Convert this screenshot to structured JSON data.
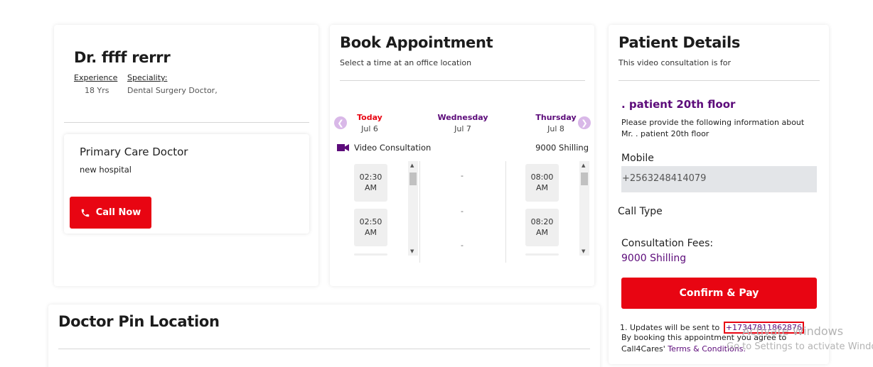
{
  "doctor": {
    "name": "Dr. ffff rerrr",
    "experience_label": "Experience",
    "experience_value": "18 Yrs",
    "speciality_label": "Speciality:",
    "speciality_value": "Dental Surgery Doctor,",
    "card_title": "Primary Care Doctor",
    "hospital": "new hospital",
    "call_button": "Call Now"
  },
  "appointment": {
    "title": "Book Appointment",
    "subtitle": "Select a time at an office location",
    "days": [
      {
        "name": "Today",
        "date": "Jul 6",
        "color": "#e80512"
      },
      {
        "name": "Wednesday",
        "date": "Jul 7",
        "color": "#5c0b7a"
      },
      {
        "name": "Thursday",
        "date": "Jul 8",
        "color": "#5c0b7a"
      }
    ],
    "consultation_type": "Video Consultation",
    "fee": "9000 Shilling",
    "slots_today": [
      {
        "time": "02:30",
        "period": "AM"
      },
      {
        "time": "02:50",
        "period": "AM"
      }
    ],
    "slots_thursday": [
      {
        "time": "08:00",
        "period": "AM"
      },
      {
        "time": "08:20",
        "period": "AM"
      }
    ],
    "empty_marker": "-"
  },
  "patient": {
    "title": "Patient Details",
    "subtitle": "This video consultation is for",
    "name": ". patient 20th floor",
    "info_line1": "Please provide the following information about",
    "info_line2": "Mr. . patient 20th floor",
    "mobile_label": "Mobile",
    "mobile_value": "+2563248414079",
    "call_type_label": "Call Type",
    "fees_label": "Consultation Fees:",
    "fees_value": "9000 Shilling",
    "confirm_button": "Confirm & Pay",
    "updates_prefix": "1. Updates will be sent to",
    "updates_number": "+17347811862876",
    "terms_line1": "By booking this appointment you agree to",
    "terms_prefix": "Call4Cares'",
    "terms_link": "Terms & Conditions."
  },
  "pin": {
    "title": "Doctor Pin Location"
  },
  "watermark": {
    "line1": "Activate Windows",
    "line2": "Go to Settings to activate Windows."
  },
  "colors": {
    "accent_red": "#e80512",
    "accent_purple": "#5c0b7a"
  }
}
